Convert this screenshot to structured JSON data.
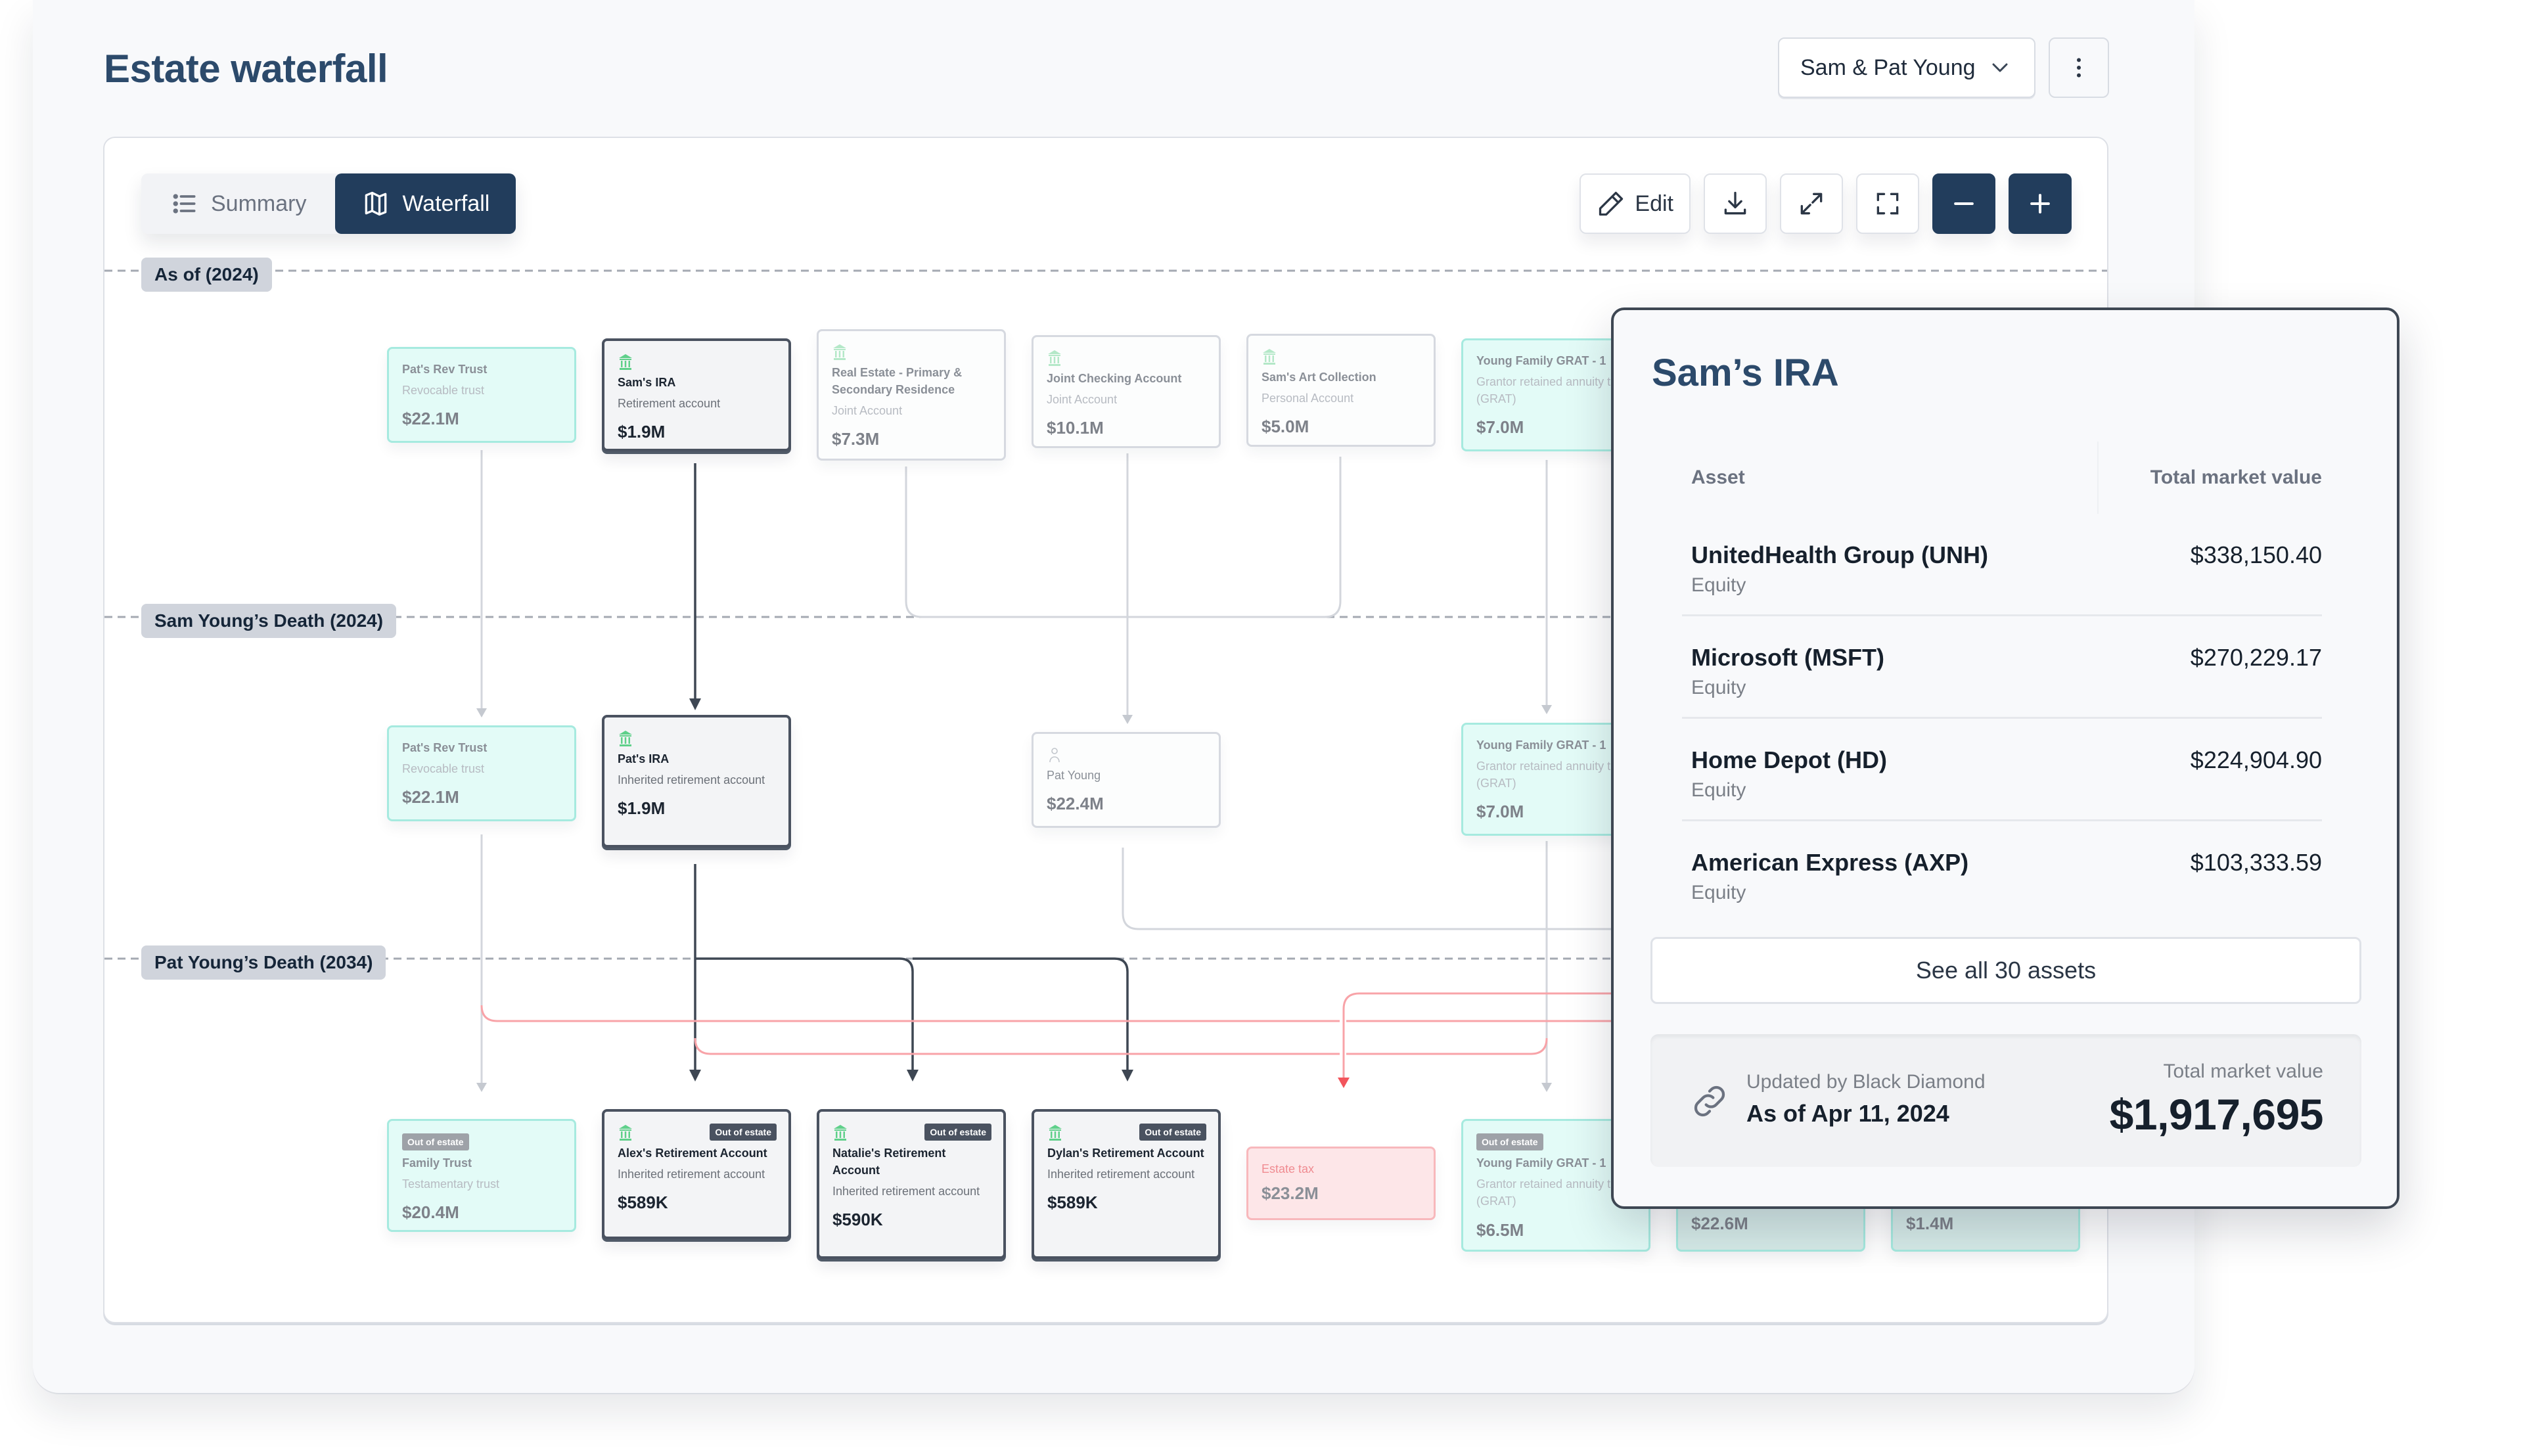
{
  "page": {
    "title": "Estate waterfall",
    "client_select": {
      "value": "Sam & Pat Young"
    }
  },
  "view_toggle": [
    {
      "label": "Summary",
      "icon": "list-icon",
      "active": false
    },
    {
      "label": "Waterfall",
      "icon": "map-icon",
      "active": true
    }
  ],
  "toolbar": {
    "edit_label": "Edit",
    "buttons": [
      "edit",
      "download",
      "expand",
      "fullscreen",
      "zoom-out",
      "zoom-in"
    ]
  },
  "timeline": [
    {
      "label": "As of (2024)"
    },
    {
      "label": "Sam Young’s Death (2024)"
    },
    {
      "label": "Pat Young’s Death (2034)"
    }
  ],
  "nodes": {
    "row1": [
      {
        "id": "pats-rev-trust-1",
        "kind": "trust",
        "title": "Pat's Rev Trust",
        "subtitle": "Revocable trust",
        "value": "$22.1M"
      },
      {
        "id": "sams-ira",
        "kind": "selected",
        "icon": "bank-icon",
        "title": "Sam's IRA",
        "subtitle": "Retirement account",
        "value": "$1.9M"
      },
      {
        "id": "real-estate",
        "kind": "account",
        "icon": "bank-icon",
        "title": "Real Estate - Primary & Secondary Residence",
        "subtitle": "Joint Account",
        "value": "$7.3M"
      },
      {
        "id": "joint-checking",
        "kind": "account",
        "icon": "bank-icon",
        "title": "Joint Checking Account",
        "subtitle": "Joint Account",
        "value": "$10.1M"
      },
      {
        "id": "art-collection",
        "kind": "account",
        "icon": "bank-icon",
        "title": "Sam's Art Collection",
        "subtitle": "Personal Account",
        "value": "$5.0M"
      },
      {
        "id": "grat-1",
        "kind": "trust",
        "title": "Young Family GRAT - 1",
        "subtitle": "Grantor retained annuity trust (GRAT)",
        "value": "$7.0M"
      }
    ],
    "row2": [
      {
        "id": "pats-rev-trust-2",
        "kind": "trust",
        "title": "Pat's Rev Trust",
        "subtitle": "Revocable trust",
        "value": "$22.1M"
      },
      {
        "id": "pats-ira",
        "kind": "selected",
        "icon": "bank-icon",
        "title": "Pat's IRA",
        "subtitle": "Inherited retirement account",
        "value": "$1.9M"
      },
      {
        "id": "pat-young",
        "kind": "account",
        "icon": "person-icon",
        "title": "Pat Young",
        "subtitle": "",
        "value": "$22.4M"
      },
      {
        "id": "grat-2",
        "kind": "trust",
        "title": "Young Family GRAT - 1",
        "subtitle": "Grantor retained annuity trust (GRAT)",
        "value": "$7.0M"
      }
    ],
    "row3": [
      {
        "id": "family-trust",
        "kind": "trust",
        "badge": "Out of estate",
        "title": "Family Trust",
        "subtitle": "Testamentary trust",
        "value": "$20.4M"
      },
      {
        "id": "alex-ret",
        "kind": "selected",
        "icon": "bank-icon",
        "badge": "Out of estate",
        "title": "Alex's Retirement Account",
        "subtitle": "Inherited retirement account",
        "value": "$589K"
      },
      {
        "id": "natalie-ret",
        "kind": "selected",
        "icon": "bank-icon",
        "badge": "Out of estate",
        "title": "Natalie's Retirement Account",
        "subtitle": "Inherited retirement account",
        "value": "$590K"
      },
      {
        "id": "dylan-ret",
        "kind": "selected",
        "icon": "bank-icon",
        "badge": "Out of estate",
        "title": "Dylan's Retirement Account",
        "subtitle": "Inherited retirement account",
        "value": "$589K"
      },
      {
        "id": "estate-tax",
        "kind": "tax",
        "title": "Estate tax",
        "subtitle": "",
        "value": "$23.2M"
      },
      {
        "id": "grat-3",
        "kind": "trust",
        "badge": "Out of estate",
        "title": "Young Family GRAT - 1",
        "subtitle": "Grantor retained annuity trust (GRAT)",
        "value": "$6.5M"
      },
      {
        "id": "hidden-a",
        "kind": "trust",
        "title": "",
        "subtitle": "",
        "value": "$22.6M"
      },
      {
        "id": "hidden-b",
        "kind": "trust",
        "title": "",
        "subtitle": "",
        "value": "$1.4M"
      }
    ]
  },
  "popover": {
    "title": "Sam’s IRA",
    "columns": {
      "asset": "Asset",
      "value": "Total market value"
    },
    "rows": [
      {
        "name": "UnitedHealth Group (UNH)",
        "type": "Equity",
        "value": "$338,150.40"
      },
      {
        "name": "Microsoft (MSFT)",
        "type": "Equity",
        "value": "$270,229.17"
      },
      {
        "name": "Home Depot (HD)",
        "type": "Equity",
        "value": "$224,904.90"
      },
      {
        "name": "American Express (AXP)",
        "type": "Equity",
        "value": "$103,333.59"
      }
    ],
    "see_all_label": "See all 30 assets",
    "footer": {
      "updated_by": "Updated by Black Diamond",
      "as_of": "As of Apr 11, 2024",
      "total_label": "Total market value",
      "total_value": "$1,917,695"
    }
  },
  "colors": {
    "brand_dark": "#223d5c",
    "title_blue": "#2c4a6b",
    "trust_fill": "#e3fbf7",
    "trust_border": "#a6eadf",
    "tax_fill": "#fde6e8",
    "tax_line": "#f58a8f",
    "bank_icon_green": "#5fd08a"
  }
}
